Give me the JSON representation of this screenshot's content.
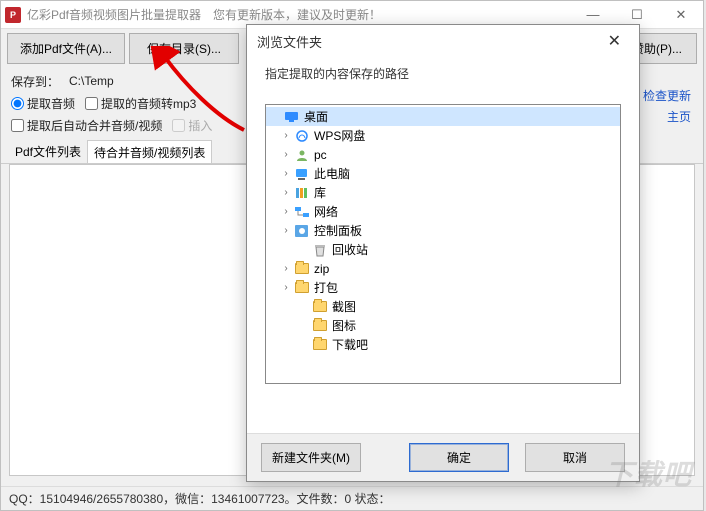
{
  "titlebar": {
    "title": "亿彩Pdf音频视频图片批量提取器",
    "update_notice": "您有更新版本，建议及时更新！",
    "min": "—",
    "max": "☐",
    "close": "✕"
  },
  "toolbar": {
    "add": "添加Pdf文件(A)...",
    "save_dir": "保存目录(S)...",
    "sponsor": "赞助(P)..."
  },
  "options": {
    "save_to_label": "保存到：",
    "save_to_path": "C:\\Temp",
    "extract_audio": "提取音频",
    "audio_to_mp3": "提取的音频转mp3",
    "auto_merge": "提取后自动合并音频/视频",
    "insert": "插入"
  },
  "lists": {
    "pdf_list": "Pdf文件列表",
    "merge_list": "待合并音频/视频列表"
  },
  "side_links": {
    "check_update": "检查更新",
    "homepage": "主页"
  },
  "statusbar": {
    "text": "QQ：15104946/2655780380，微信：13461007723。文件数：0   状态："
  },
  "dialog": {
    "title": "浏览文件夹",
    "instruction": "指定提取的内容保存的路径",
    "new_folder": "新建文件夹(M)",
    "ok": "确定",
    "cancel": "取消"
  },
  "tree": [
    {
      "level": 0,
      "expander": "",
      "icon": "desktop",
      "label": "桌面",
      "selected": true
    },
    {
      "level": 1,
      "expander": "›",
      "icon": "wps",
      "label": "WPS网盘"
    },
    {
      "level": 1,
      "expander": "›",
      "icon": "user",
      "label": "pc"
    },
    {
      "level": 1,
      "expander": "›",
      "icon": "pc",
      "label": "此电脑"
    },
    {
      "level": 1,
      "expander": "›",
      "icon": "lib",
      "label": "库"
    },
    {
      "level": 1,
      "expander": "›",
      "icon": "net",
      "label": "网络"
    },
    {
      "level": 1,
      "expander": "›",
      "icon": "cpl",
      "label": "控制面板"
    },
    {
      "level": 2,
      "expander": "",
      "icon": "bin",
      "label": "回收站"
    },
    {
      "level": 1,
      "expander": "›",
      "icon": "folder",
      "label": "zip"
    },
    {
      "level": 1,
      "expander": "›",
      "icon": "folder",
      "label": "打包"
    },
    {
      "level": 2,
      "expander": "",
      "icon": "folder",
      "label": "截图"
    },
    {
      "level": 2,
      "expander": "",
      "icon": "folder",
      "label": "图标"
    },
    {
      "level": 2,
      "expander": "",
      "icon": "folder",
      "label": "下载吧"
    }
  ],
  "watermark": "下载吧"
}
